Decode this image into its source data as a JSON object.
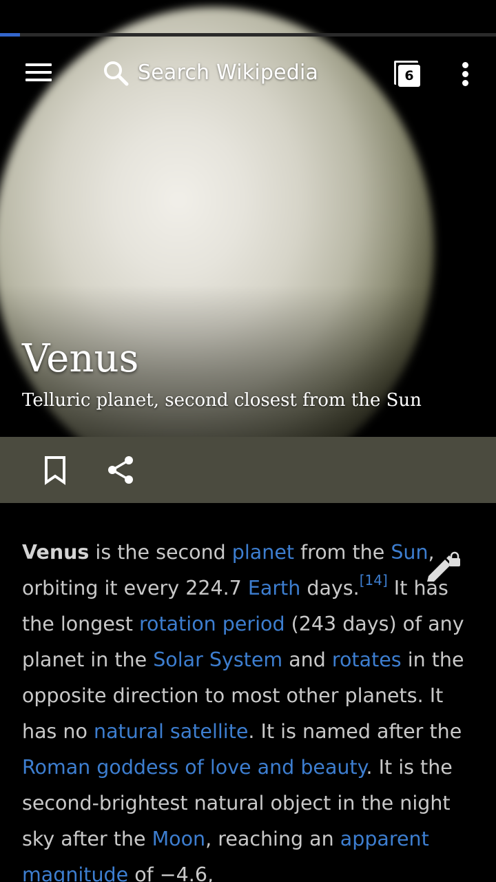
{
  "loading": {
    "progress": 0.04,
    "color": "#3366cc"
  },
  "toolbar": {
    "menu_icon": "hamburger-menu-icon",
    "search_icon": "search-icon",
    "search_placeholder": "Search Wikipedia",
    "tabs_count": "6",
    "overflow_icon": "more-vertical-icon"
  },
  "article": {
    "title": "Venus",
    "description": "Telluric planet, second closest from the Sun",
    "actions": {
      "save_icon": "bookmark-icon",
      "share_icon": "share-icon",
      "edit_icon": "edit-locked-icon"
    },
    "lead": [
      {
        "text": "Venus",
        "bold": true
      },
      {
        "text": " is the second "
      },
      {
        "text": "planet",
        "link": true
      },
      {
        "text": " from the "
      },
      {
        "text": "Sun",
        "link": true
      },
      {
        "text": ", orbiting it every 224.7 "
      },
      {
        "text": "Earth",
        "link": true
      },
      {
        "text": " days."
      },
      {
        "text": "[14]",
        "link": true,
        "sup": true
      },
      {
        "text": " It has the longest "
      },
      {
        "text": "rotation period",
        "link": true
      },
      {
        "text": " (243 days) of any planet in the "
      },
      {
        "text": "Solar System",
        "link": true
      },
      {
        "text": " and "
      },
      {
        "text": "rotates",
        "link": true
      },
      {
        "text": " in the opposite direction to most other planets. It has no "
      },
      {
        "text": "natural satellite",
        "link": true
      },
      {
        "text": ". It is named after the "
      },
      {
        "text": "Roman goddess of love and beauty",
        "link": true
      },
      {
        "text": ". It is the second-brightest natural object in the night sky after the "
      },
      {
        "text": "Moon",
        "link": true
      },
      {
        "text": ", reaching an "
      },
      {
        "text": "apparent magnitude",
        "link": true
      },
      {
        "text": " of −4.6,"
      }
    ]
  },
  "colors": {
    "background": "#000000",
    "action_bar": "#4b4b3f",
    "link": "#3d7ed0",
    "body_text": "#c9c9c9"
  }
}
